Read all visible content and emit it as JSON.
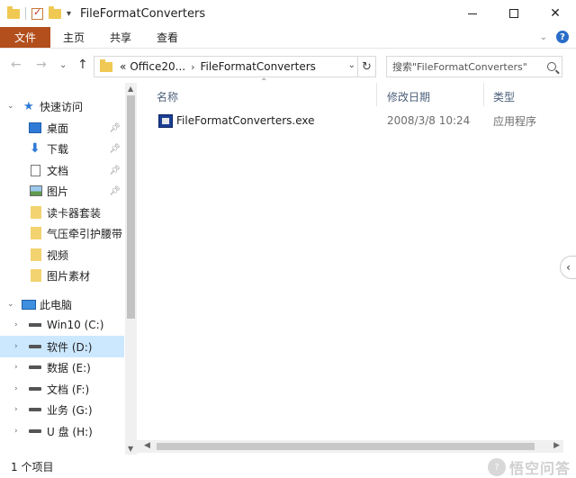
{
  "window": {
    "title": "FileFormatConverters"
  },
  "ribbon": {
    "tabs": [
      "文件",
      "主页",
      "共享",
      "查看"
    ]
  },
  "address": {
    "overflow": "«",
    "crumbs": [
      "Office20...",
      "FileFormatConverters"
    ]
  },
  "search": {
    "placeholder": "搜索\"FileFormatConverters\""
  },
  "nav": {
    "quick_access": "快速访问",
    "items": [
      {
        "label": "桌面",
        "icon": "desktop-icon",
        "pinned": true
      },
      {
        "label": "下载",
        "icon": "download-icon",
        "pinned": true
      },
      {
        "label": "文档",
        "icon": "document-icon",
        "pinned": true
      },
      {
        "label": "图片",
        "icon": "picture-icon",
        "pinned": true
      },
      {
        "label": "读卡器套装",
        "icon": "folder-icon",
        "pinned": false
      },
      {
        "label": "气压牵引护腰带",
        "icon": "folder-icon",
        "pinned": false
      },
      {
        "label": "视频",
        "icon": "folder-icon",
        "pinned": false
      },
      {
        "label": "图片素材",
        "icon": "folder-icon",
        "pinned": false
      }
    ],
    "this_pc": "此电脑",
    "drives": [
      {
        "label": "Win10 (C:)",
        "icon": "windows-drive-icon",
        "selected": false
      },
      {
        "label": "软件 (D:)",
        "icon": "drive-icon",
        "selected": true
      },
      {
        "label": "数据 (E:)",
        "icon": "drive-icon",
        "selected": false
      },
      {
        "label": "文档 (F:)",
        "icon": "drive-icon",
        "selected": false
      },
      {
        "label": "业务 (G:)",
        "icon": "drive-icon",
        "selected": false
      },
      {
        "label": "U 盘 (H:)",
        "icon": "drive-icon",
        "selected": false
      }
    ]
  },
  "columns": {
    "name": "名称",
    "modified": "修改日期",
    "type": "类型"
  },
  "files": [
    {
      "name": "FileFormatConverters.exe",
      "modified": "2008/3/8 10:24",
      "type": "应用程序",
      "icon": "exe-icon"
    }
  ],
  "status": {
    "count": "1 个项目"
  },
  "watermark": {
    "text": "悟空问答"
  },
  "colors": {
    "file_tab": "#b24f1c",
    "selection": "#cce8ff",
    "accent": "#2f7ad6"
  }
}
